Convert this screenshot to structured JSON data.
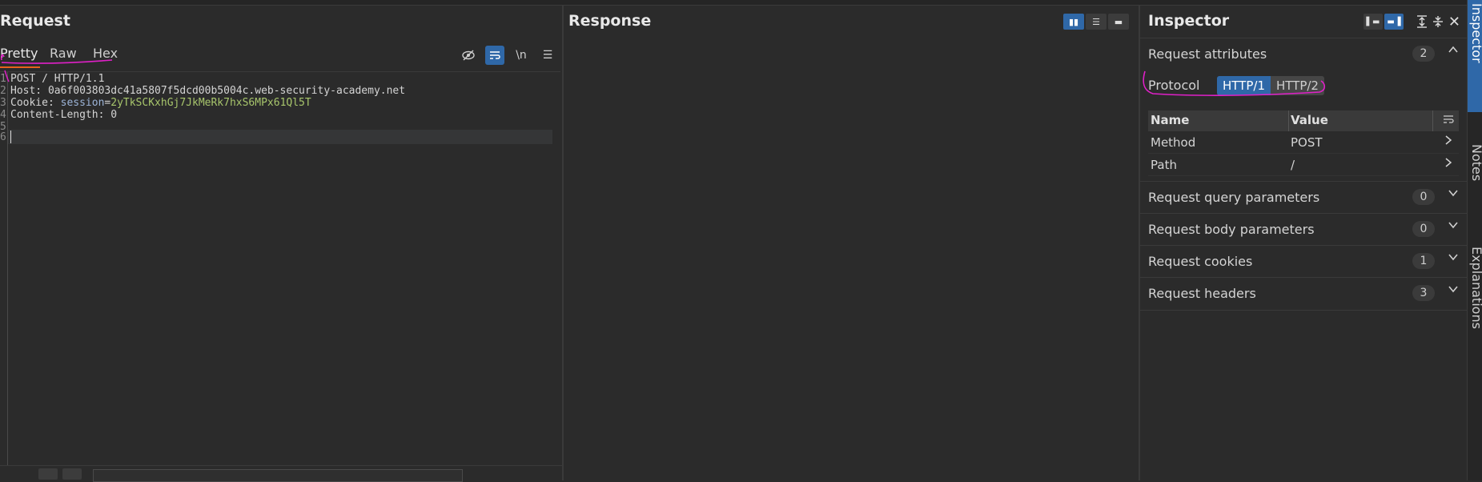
{
  "request": {
    "title": "Request",
    "tabs": [
      {
        "label": "Pretty"
      },
      {
        "label": "Raw"
      },
      {
        "label": "Hex"
      }
    ],
    "toolbar": {
      "hide_label": "",
      "wrap_label": "",
      "newline_label": "\\n",
      "menu_label": "☰"
    },
    "lines": [
      {
        "num": "1",
        "text": "POST / HTTP/1.1"
      },
      {
        "num": "2",
        "key": "Host:",
        "value": " 0a6f003803dc41a5807f5dcd00b5004c.web-security-academy.net"
      },
      {
        "num": "3",
        "key": "Cookie:",
        "cookie_name": " session",
        "eq": "=",
        "cookie_value": "2yTkSCKxhGj7JkMeRk7hxS6MPx61Ql5T"
      },
      {
        "num": "4",
        "key": "Content-Length:",
        "value": " 0"
      },
      {
        "num": "5",
        "text": ""
      },
      {
        "num": "6",
        "text": ""
      }
    ]
  },
  "response": {
    "title": "Response"
  },
  "inspector": {
    "title": "Inspector",
    "sections": [
      {
        "label": "Request attributes",
        "count": "2",
        "expanded": true
      },
      {
        "label": "Request query parameters",
        "count": "0"
      },
      {
        "label": "Request body parameters",
        "count": "0"
      },
      {
        "label": "Request cookies",
        "count": "1"
      },
      {
        "label": "Request headers",
        "count": "3"
      }
    ],
    "protocol": {
      "label": "Protocol",
      "options": [
        "HTTP/1",
        "HTTP/2"
      ],
      "selected": "HTTP/1"
    },
    "attr_table": {
      "headers": [
        "Name",
        "Value"
      ],
      "rows": [
        {
          "name": "Method",
          "value": "POST"
        },
        {
          "name": "Path",
          "value": "/"
        }
      ]
    }
  },
  "rail": {
    "tabs": [
      "Inspector",
      "Notes",
      "Explanations"
    ]
  },
  "colors": {
    "accent": "#2f68a8",
    "tab_underline": "#e8621c",
    "annotation": "#e020c8"
  }
}
